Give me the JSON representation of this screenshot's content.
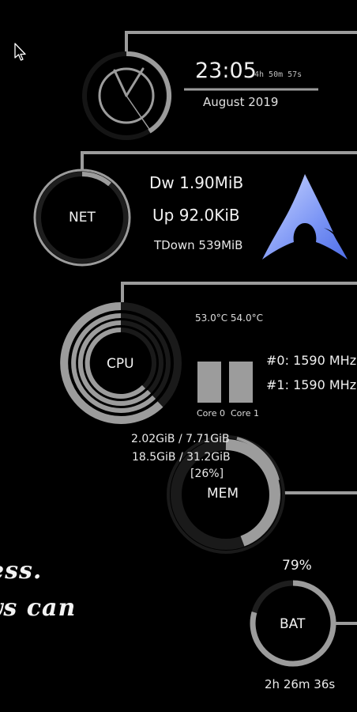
{
  "clock": {
    "time": "23:05",
    "uptime": "4h 50m 57s",
    "date": "August 2019"
  },
  "net": {
    "label": "NET",
    "down": "Dw  1.90MiB",
    "up": "Up  92.0KiB",
    "total_down": "TDown  539MiB"
  },
  "cpu": {
    "label": "CPU",
    "temps": "53.0°C  54.0°C",
    "freq0": "#0:  1590 MHz",
    "freq1": "#1:  1590 MHz",
    "core0_label": "Core 0",
    "core1_label": "Core 1",
    "core0_usage": 1.0,
    "core1_usage": 1.0
  },
  "mem": {
    "label": "MEM",
    "ram": "2.02GiB / 7.71GiB",
    "swap": "18.5GiB / 31.2GiB",
    "percent": "[26%]"
  },
  "bat": {
    "label": "BAT",
    "percent": "79%",
    "time_left": "2h 26m 36s"
  },
  "quote": {
    "line1": "ess.",
    "line2": "ys can"
  },
  "colors": {
    "background": "#000000",
    "ring": "#9c9c9c",
    "ring_dim": "#1e1e1e",
    "arch_blue": "#5b7cf0"
  },
  "icons": {
    "cursor": "mouse-pointer-icon",
    "distro": "arch-linux-logo-icon"
  }
}
